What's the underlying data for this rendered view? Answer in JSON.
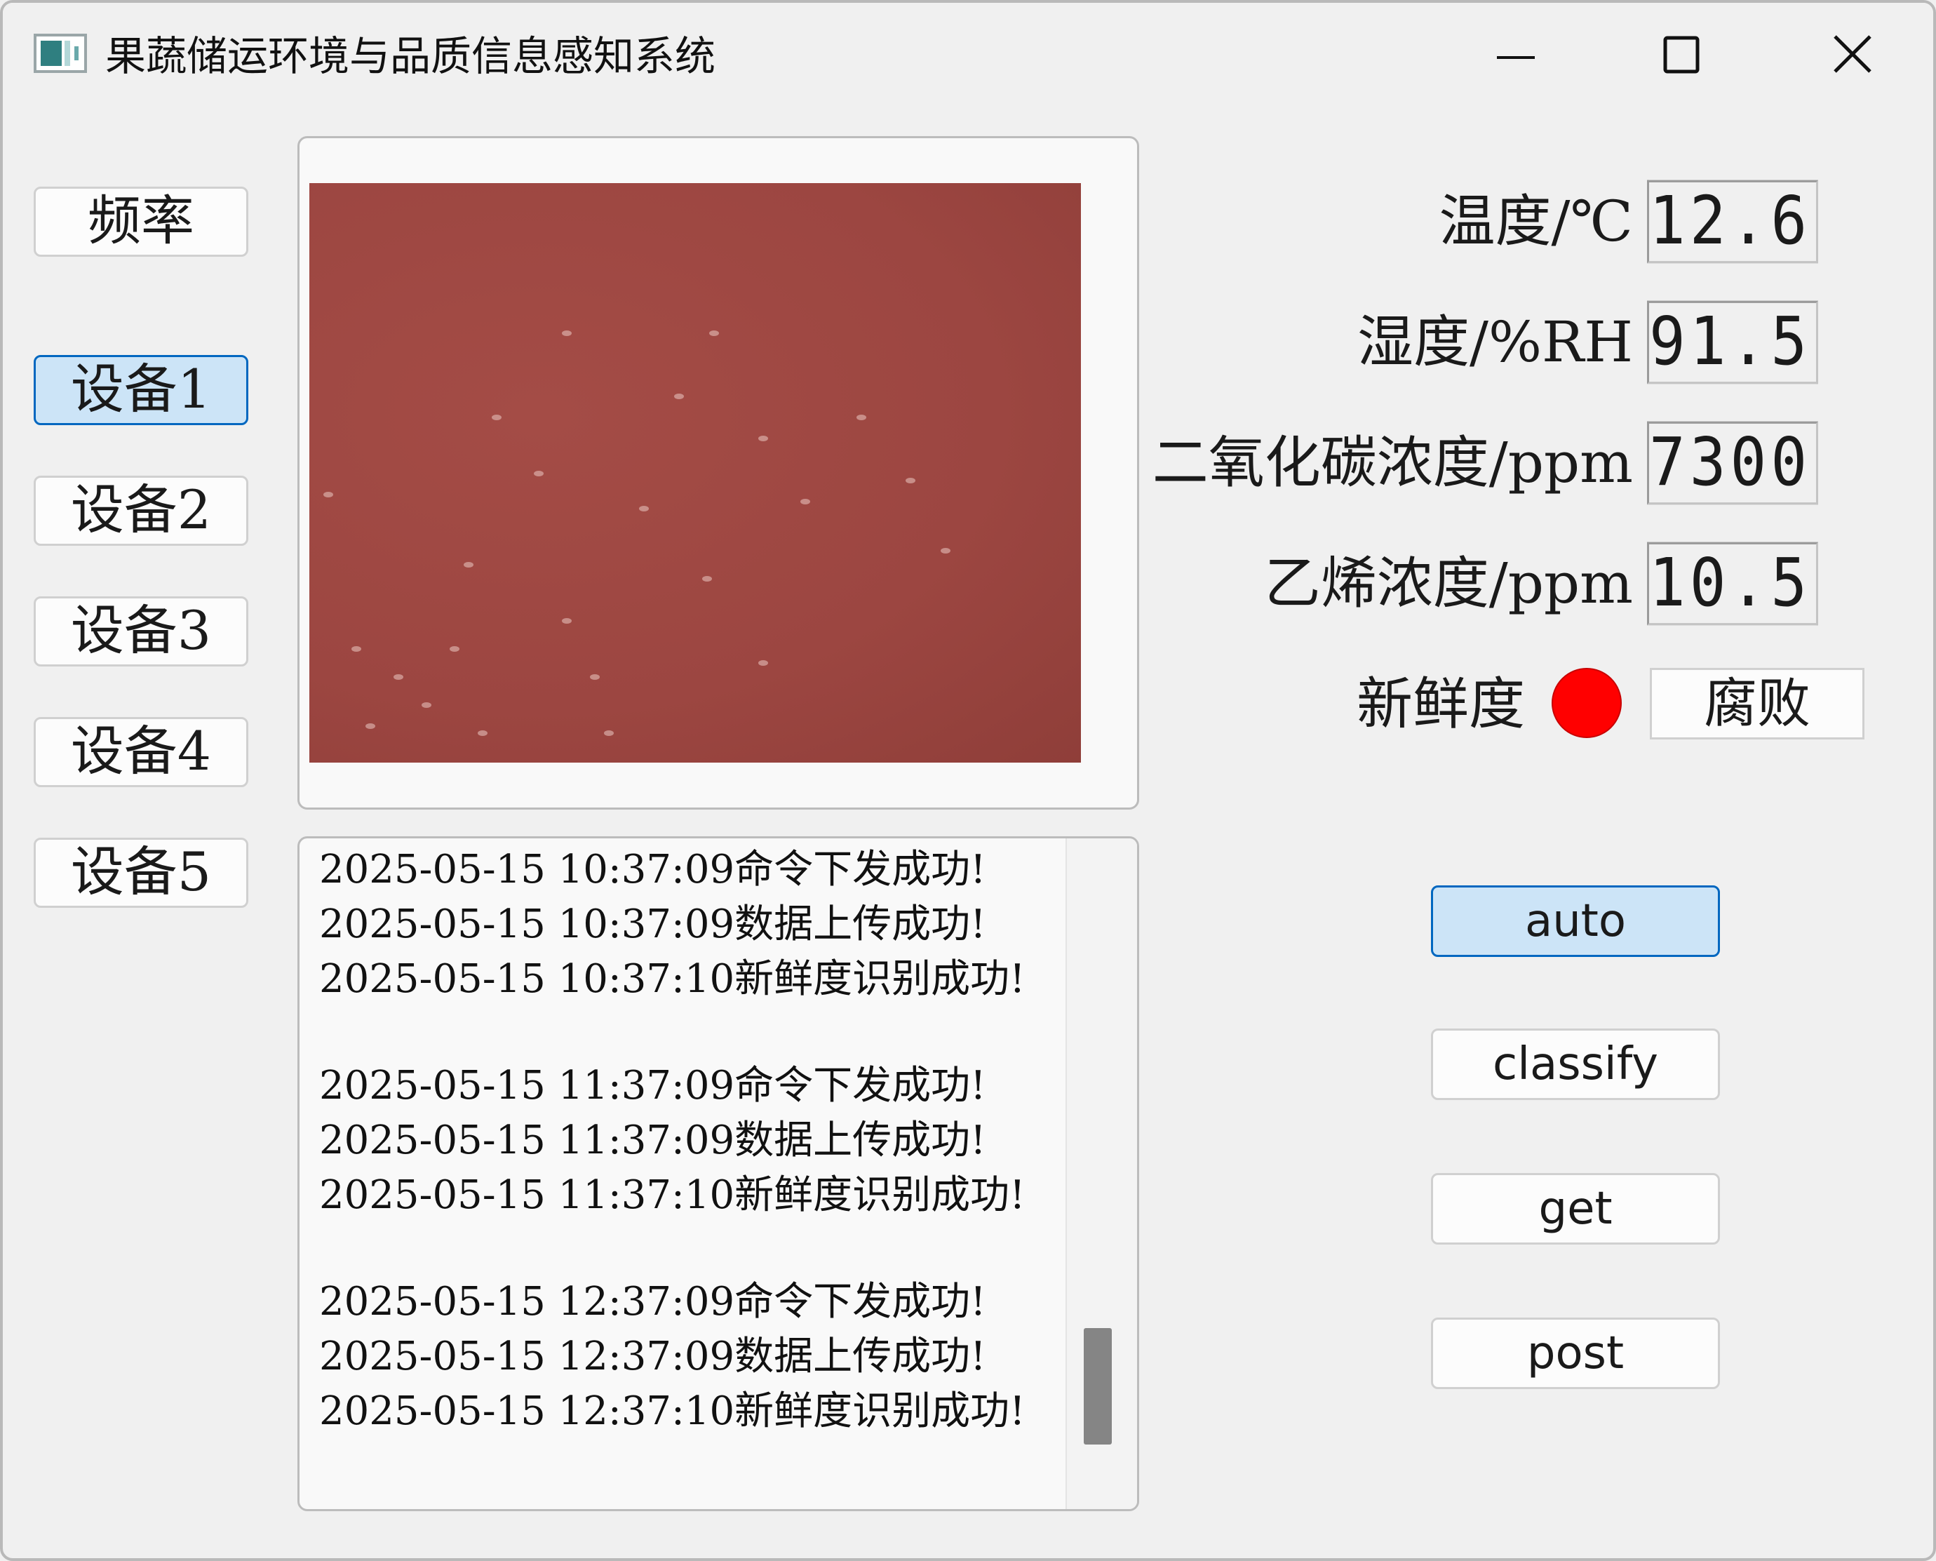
{
  "window": {
    "title": "果蔬储运环境与品质信息感知系统",
    "icon": "app-window-icon"
  },
  "sidebar": {
    "frequency_label": "频率",
    "devices": [
      {
        "label": "设备1",
        "selected": true
      },
      {
        "label": "设备2",
        "selected": false
      },
      {
        "label": "设备3",
        "selected": false
      },
      {
        "label": "设备4",
        "selected": false
      },
      {
        "label": "设备5",
        "selected": false
      }
    ]
  },
  "log": {
    "lines": [
      "2025-05-15 10:37:09命令下发成功!",
      "2025-05-15 10:37:09数据上传成功!",
      "2025-05-15 10:37:10新鲜度识别成功!",
      "",
      "2025-05-15 11:37:09命令下发成功!",
      "2025-05-15 11:37:09数据上传成功!",
      "2025-05-15 11:37:10新鲜度识别成功!",
      "",
      "2025-05-15 12:37:09命令下发成功!",
      "2025-05-15 12:37:09数据上传成功!",
      "2025-05-15 12:37:10新鲜度识别成功!"
    ]
  },
  "sensors": {
    "temperature": {
      "label": "温度/℃",
      "value": "12.6"
    },
    "humidity": {
      "label": "湿度/%RH",
      "value": "91.5"
    },
    "co2": {
      "label": "二氧化碳浓度/ppm",
      "value": "7300"
    },
    "ethylene": {
      "label": "乙烯浓度/ppm",
      "value": "10.5"
    }
  },
  "freshness": {
    "label": "新鲜度",
    "status": "腐败",
    "indicator_color": "#ff0000"
  },
  "actions": {
    "auto": "auto",
    "classify": "classify",
    "get": "get",
    "post": "post"
  },
  "colors": {
    "selected_bg": "#cce4f7",
    "selected_border": "#0067c0",
    "image_tint": "#9c4641"
  }
}
